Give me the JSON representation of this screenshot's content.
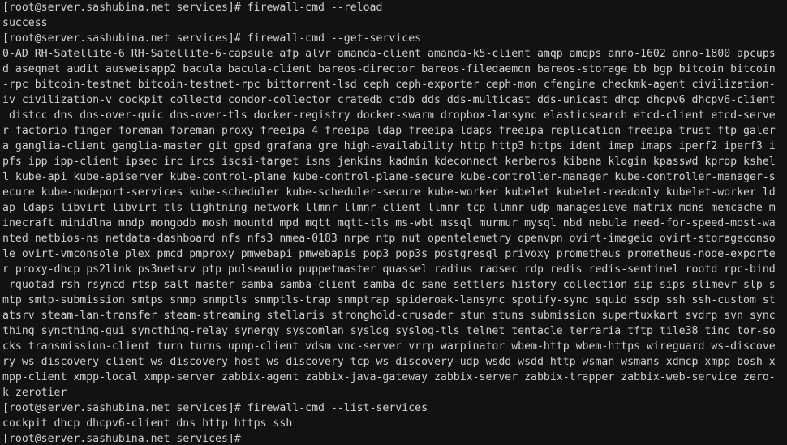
{
  "terminal": {
    "lines": [
      "[root@server.sashubina.net services]# firewall-cmd --reload",
      "success",
      "[root@server.sashubina.net services]# firewall-cmd --get-services",
      "0-AD RH-Satellite-6 RH-Satellite-6-capsule afp alvr amanda-client amanda-k5-client amqp amqps anno-1602 anno-1800 apcups",
      "d aseqnet audit ausweisapp2 bacula bacula-client bareos-director bareos-filedaemon bareos-storage bb bgp bitcoin bitcoin",
      "-rpc bitcoin-testnet bitcoin-testnet-rpc bittorrent-lsd ceph ceph-exporter ceph-mon cfengine checkmk-agent civilization-",
      "iv civilization-v cockpit collectd condor-collector cratedb ctdb dds dds-multicast dds-unicast dhcp dhcpv6 dhcpv6-client",
      " distcc dns dns-over-quic dns-over-tls docker-registry docker-swarm dropbox-lansync elasticsearch etcd-client etcd-serve",
      "r factorio finger foreman foreman-proxy freeipa-4 freeipa-ldap freeipa-ldaps freeipa-replication freeipa-trust ftp galer",
      "a ganglia-client ganglia-master git gpsd grafana gre high-availability http http3 https ident imap imaps iperf2 iperf3 i",
      "pfs ipp ipp-client ipsec irc ircs iscsi-target isns jenkins kadmin kdeconnect kerberos kibana klogin kpasswd kprop kshel",
      "l kube-api kube-apiserver kube-control-plane kube-control-plane-secure kube-controller-manager kube-controller-manager-s",
      "ecure kube-nodeport-services kube-scheduler kube-scheduler-secure kube-worker kubelet kubelet-readonly kubelet-worker ld",
      "ap ldaps libvirt libvirt-tls lightning-network llmnr llmnr-client llmnr-tcp llmnr-udp managesieve matrix mdns memcache m",
      "inecraft minidlna mndp mongodb mosh mountd mpd mqtt mqtt-tls ms-wbt mssql murmur mysql nbd nebula need-for-speed-most-wa",
      "nted netbios-ns netdata-dashboard nfs nfs3 nmea-0183 nrpe ntp nut opentelemetry openvpn ovirt-imageio ovirt-storageconso",
      "le ovirt-vmconsole plex pmcd pmproxy pmwebapi pmwebapis pop3 pop3s postgresql privoxy prometheus prometheus-node-exporte",
      "r proxy-dhcp ps2link ps3netsrv ptp pulseaudio puppetmaster quassel radius radsec rdp redis redis-sentinel rootd rpc-bind",
      " rquotad rsh rsyncd rtsp salt-master samba samba-client samba-dc sane settlers-history-collection sip sips slimevr slp s",
      "mtp smtp-submission smtps snmp snmptls snmptls-trap snmptrap spideroak-lansync spotify-sync squid ssdp ssh ssh-custom st",
      "atsrv steam-lan-transfer steam-streaming stellaris stronghold-crusader stun stuns submission supertuxkart svdrp svn sync",
      "thing syncthing-gui syncthing-relay synergy syscomlan syslog syslog-tls telnet tentacle terraria tftp tile38 tinc tor-so",
      "cks transmission-client turn turns upnp-client vdsm vnc-server vrrp warpinator wbem-http wbem-https wireguard ws-discove",
      "ry ws-discovery-client ws-discovery-host ws-discovery-tcp ws-discovery-udp wsdd wsdd-http wsman wsmans xdmcp xmpp-bosh x",
      "mpp-client xmpp-local xmpp-server zabbix-agent zabbix-java-gateway zabbix-server zabbix-trapper zabbix-web-service zero-",
      "k zerotier",
      "[root@server.sashubina.net services]# firewall-cmd --list-services",
      "cockpit dhcp dhcpv6-client dns http https ssh",
      "[root@server.sashubina.net services]# "
    ],
    "colors": {
      "background": "#121212",
      "foreground": "#d0d0d0"
    }
  }
}
